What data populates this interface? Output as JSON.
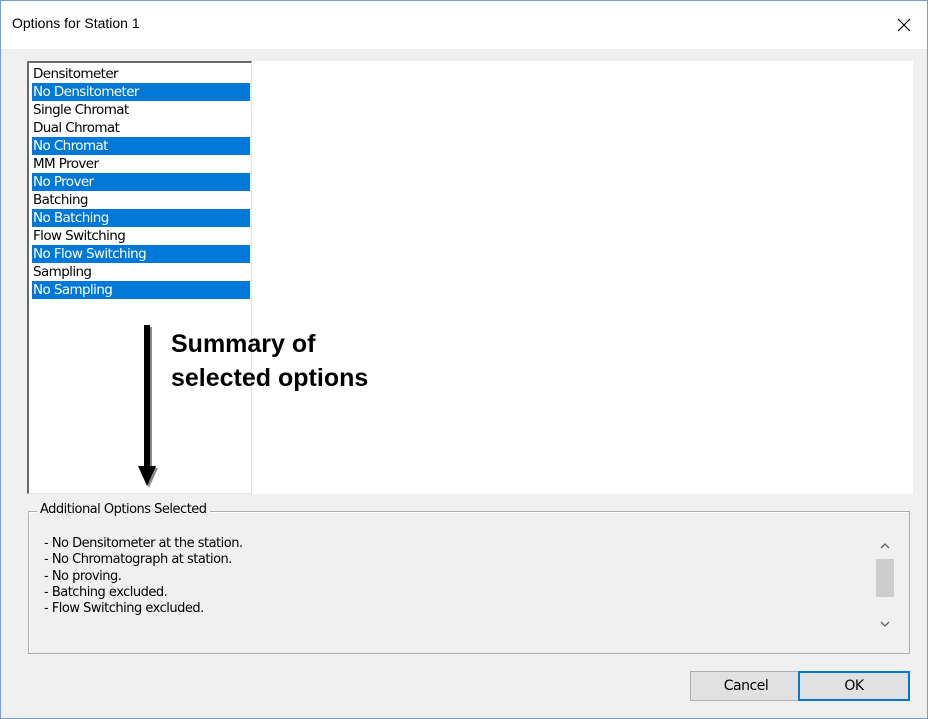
{
  "window": {
    "title": "Options for Station 1"
  },
  "options_list": {
    "items": [
      {
        "label": "Densitometer",
        "selected": false
      },
      {
        "label": "No Densitometer",
        "selected": true
      },
      {
        "label": "Single Chromat",
        "selected": false
      },
      {
        "label": "Dual Chromat",
        "selected": false
      },
      {
        "label": "No Chromat",
        "selected": true
      },
      {
        "label": "MM Prover",
        "selected": false
      },
      {
        "label": "No Prover",
        "selected": true
      },
      {
        "label": "Batching",
        "selected": false
      },
      {
        "label": "No Batching",
        "selected": true
      },
      {
        "label": "Flow Switching",
        "selected": false
      },
      {
        "label": "No Flow Switching",
        "selected": true
      },
      {
        "label": "Sampling",
        "selected": false
      },
      {
        "label": "No Sampling",
        "selected": true
      }
    ]
  },
  "annotation": {
    "line1": "Summary of",
    "line2": "selected options"
  },
  "additional_options": {
    "legend": "Additional Options Selected",
    "lines": [
      "- No Densitometer at the station.",
      "- No Chromatograph at station.",
      "- No proving.",
      "- Batching excluded.",
      "- Flow Switching excluded."
    ]
  },
  "buttons": {
    "cancel": "Cancel",
    "ok": "OK"
  },
  "colors": {
    "selection": "#0078d7",
    "selection_text": "#ffffff",
    "dialog_bg": "#f0f0f0"
  },
  "icons": {
    "close": "close-icon",
    "scroll_up": "chevron-up-icon",
    "scroll_down": "chevron-down-icon",
    "annotation": "arrow-down-icon"
  }
}
